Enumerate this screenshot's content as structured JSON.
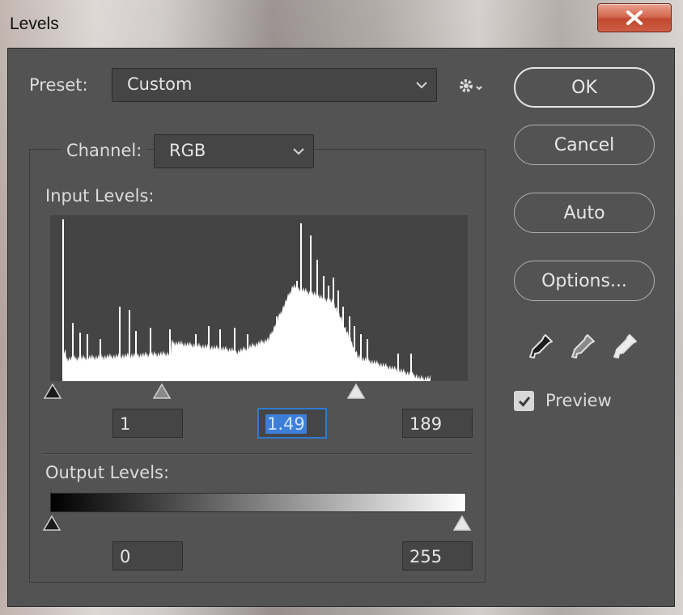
{
  "window": {
    "title": "Levels"
  },
  "preset": {
    "label": "Preset:",
    "value": "Custom"
  },
  "channel": {
    "label": "Channel:",
    "value": "RGB"
  },
  "input_levels": {
    "label": "Input Levels:",
    "black": "1",
    "gamma": "1.49",
    "white": "189"
  },
  "output_levels": {
    "label": "Output Levels:",
    "black": "0",
    "white": "255"
  },
  "buttons": {
    "ok": "OK",
    "cancel": "Cancel",
    "auto": "Auto",
    "options": "Options..."
  },
  "preview": {
    "label": "Preview",
    "checked": true
  },
  "icons": {
    "close": "close-icon",
    "preset_settings": "gear-icon",
    "dropdown": "chevron-down-icon",
    "black_eyedropper": "eyedropper-black-icon",
    "gray_eyedropper": "eyedropper-gray-icon",
    "white_eyedropper": "eyedropper-white-icon"
  },
  "colors": {
    "panel": "#535353",
    "focus": "#2e7bd1",
    "close_button": "#c8563c"
  }
}
